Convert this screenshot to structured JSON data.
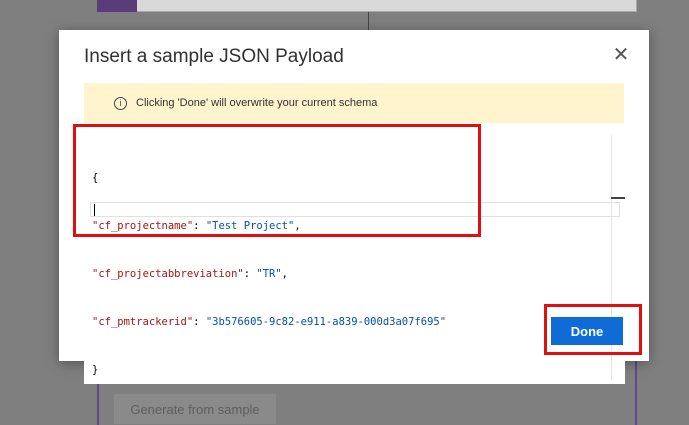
{
  "background": {
    "generate_button_label": "Generate from sample"
  },
  "dialog": {
    "title": "Insert a sample JSON Payload",
    "close_icon": "close-icon",
    "warning": {
      "icon": "info-icon",
      "icon_glyph": "i",
      "text": "Clicking 'Done' will overwrite your current schema"
    },
    "editor": {
      "open_brace": "{",
      "close_brace": "}",
      "lines": [
        {
          "key": "\"cf_projectname\"",
          "sep": ": ",
          "value": "\"Test Project\"",
          "trail": ","
        },
        {
          "key": "\"cf_projectabbreviation\"",
          "sep": ": ",
          "value": "\"TR\"",
          "trail": ","
        },
        {
          "key": "\"cf_pmtrackerid\"",
          "sep": ": ",
          "value": "\"3b576605-9c82-e911-a839-000d3a07f695\"",
          "trail": ""
        }
      ]
    },
    "done_label": "Done"
  },
  "colors": {
    "primary_button": "#0f6cd6",
    "warning_bg": "#fff4ce",
    "json_key": "#a31515",
    "json_string": "#0451a5",
    "highlight": "#e01010"
  }
}
